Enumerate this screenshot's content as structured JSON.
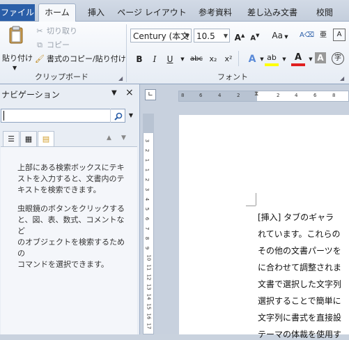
{
  "tabs": {
    "file": "ファイル",
    "items": [
      "ホーム",
      "挿入",
      "ページ レイアウト",
      "参考資料",
      "差し込み文書",
      "校閲"
    ],
    "active": "ホーム"
  },
  "clipboard": {
    "paste_label": "貼り付け",
    "cut_label": "切り取り",
    "copy_label": "コピー",
    "format_painter_label": "書式のコピー/貼り付け",
    "group_label": "クリップボード"
  },
  "font": {
    "font_name": "Century (本文",
    "font_size": "10.5",
    "group_label": "フォント",
    "aa_label": "Aa",
    "buttons": {
      "bold": "B",
      "italic": "I",
      "underline": "U",
      "strike": "abc",
      "subscript": "x₂",
      "superscript": "x²"
    }
  },
  "navigation": {
    "title": "ナビゲーション",
    "search_value": "",
    "info_paragraph_1": [
      "上部にある検索ボックスにテキ",
      "ストを入力すると、文書内のテ",
      "キストを検索できます。"
    ],
    "info_paragraph_2": [
      "虫眼鏡のボタンをクリックする",
      "と、図、表、数式、コメントなど",
      "のオブジェクトを検索するための",
      "コマンドを選択できます。"
    ]
  },
  "ruler": {
    "horizontal_ticks": [
      "8",
      "6",
      "4",
      "2",
      "2",
      "4",
      "6",
      "8"
    ],
    "vertical_ticks": [
      "5",
      "4",
      "3",
      "2",
      "1",
      "1",
      "2",
      "3",
      "4",
      "5",
      "6",
      "7",
      "8",
      "9",
      "10",
      "11",
      "12",
      "13",
      "14",
      "15",
      "16",
      "17"
    ]
  },
  "document": {
    "lines": [
      "[挿入] タブのギャラ",
      "れています。これらの",
      "その他の文書パーツを",
      "に合わせて調整されま",
      "文書で選択した文字列",
      "選択することで簡単に",
      "文字列に書式を直接設",
      "テーマの体裁を使用す"
    ]
  },
  "colors": {
    "file_tab": "#2a5ea8",
    "highlight_yellow": "#ffff00",
    "font_color_red": "#e02020"
  }
}
